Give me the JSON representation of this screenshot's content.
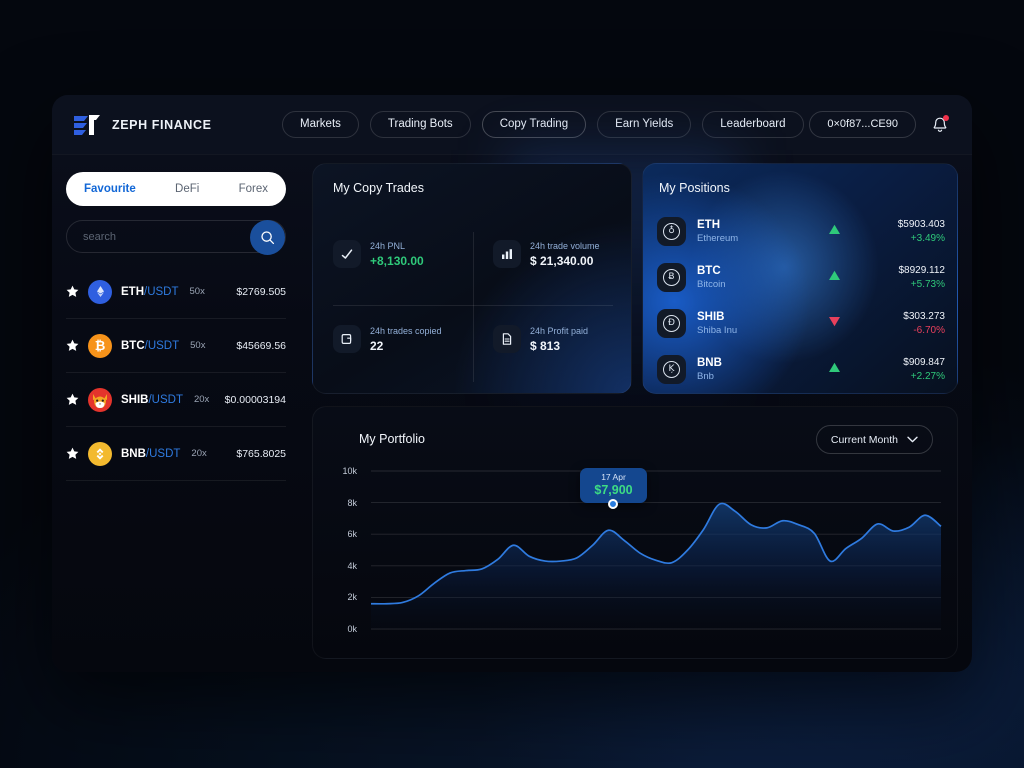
{
  "brand": {
    "name": "ZEPH FINANCE",
    "logo_icon": "zeph-logo-icon"
  },
  "nav": {
    "items": [
      {
        "label": "Markets",
        "active": false
      },
      {
        "label": "Trading Bots",
        "active": false
      },
      {
        "label": "Copy Trading",
        "active": true
      },
      {
        "label": "Earn Yields",
        "active": false
      },
      {
        "label": "Leaderboard",
        "active": false
      }
    ],
    "wallet": "0×0f87...CE90",
    "notification_icon": "bell-icon"
  },
  "sidebar": {
    "tabs": [
      {
        "label": "Favourite",
        "active": true
      },
      {
        "label": "DeFi",
        "active": false
      },
      {
        "label": "Forex",
        "active": false
      }
    ],
    "search": {
      "placeholder": "search",
      "value": "",
      "icon": "search-icon"
    },
    "coins": [
      {
        "base": "ETH",
        "quote": "/USDT",
        "leverage": "50x",
        "price": "$2769.505",
        "color": "#2f5fe0",
        "glyph": "Ξ",
        "favourite": true
      },
      {
        "base": "BTC",
        "quote": "/USDT",
        "leverage": "50x",
        "price": "$45669.56",
        "color": "#f7931a",
        "glyph": "₿",
        "favourite": true
      },
      {
        "base": "SHIB",
        "quote": "/USDT",
        "leverage": "20x",
        "price": "$0.00003194",
        "color": "#e4342c",
        "glyph": "🐶",
        "favourite": true
      },
      {
        "base": "BNB",
        "quote": "/USDT",
        "leverage": "20x",
        "price": "$765.8025",
        "color": "#f3ba2f",
        "glyph": "◈",
        "favourite": true
      }
    ]
  },
  "copy_trades": {
    "title": "My Copy Trades",
    "stats": [
      {
        "label": "24h PNL",
        "value": "+8,130.00",
        "positive": true,
        "icon": "check-icon"
      },
      {
        "label": "24h trade volume",
        "value": "$ 21,340.00",
        "positive": false,
        "icon": "bar-chart-icon"
      },
      {
        "label": "24h trades copied",
        "value": "22",
        "positive": false,
        "icon": "copy-icon"
      },
      {
        "label": "24h Profit paid",
        "value": "$ 813",
        "positive": false,
        "icon": "document-icon"
      }
    ]
  },
  "positions": {
    "title": "My Positions",
    "rows": [
      {
        "symbol": "ETH",
        "name": "Ethereum",
        "price": "$5903.403",
        "change": "+3.49%",
        "direction": "up",
        "glyph": "♁"
      },
      {
        "symbol": "BTC",
        "name": "Bitcoin",
        "price": "$8929.112",
        "change": "+5.73%",
        "direction": "up",
        "glyph": "Ƀ"
      },
      {
        "symbol": "SHIB",
        "name": "Shiba Inu",
        "price": "$303.273",
        "change": "-6.70%",
        "direction": "down",
        "glyph": "Ð"
      },
      {
        "symbol": "BNB",
        "name": "Bnb",
        "price": "$909.847",
        "change": "+2.27%",
        "direction": "up",
        "glyph": "Ķ"
      }
    ]
  },
  "portfolio": {
    "title": "My Portfolio",
    "period": {
      "label": "Current Month",
      "icon": "chevron-down-icon"
    },
    "tooltip": {
      "date": "17 Apr",
      "value": "$7,900"
    }
  },
  "chart_data": {
    "type": "area",
    "title": "My Portfolio",
    "xlabel": "",
    "ylabel": "",
    "ylim": [
      0,
      10000
    ],
    "ytick_labels": [
      "0k",
      "2k",
      "4k",
      "6k",
      "8k",
      "10k"
    ],
    "ytick_values": [
      0,
      2000,
      4000,
      6000,
      8000,
      10000
    ],
    "grid": true,
    "legend": false,
    "line_color": "#2f7be0",
    "fill_color": "#0c2katsu",
    "annotations": [
      {
        "x": 17,
        "y": 7900,
        "date": "17 Apr",
        "label": "$7,900"
      }
    ],
    "series": [
      {
        "name": "Portfolio value",
        "x": [
          0,
          1,
          2,
          3,
          4,
          5,
          6,
          7,
          8,
          9,
          10,
          11,
          12,
          13,
          14,
          15,
          16,
          17,
          18,
          19,
          20,
          21,
          22,
          23,
          24,
          25,
          26,
          27,
          28,
          29,
          30,
          31,
          32,
          33,
          34,
          35,
          36
        ],
        "values": [
          1600,
          1600,
          1680,
          2100,
          2900,
          3550,
          3700,
          3800,
          4400,
          5300,
          4600,
          4300,
          4300,
          4500,
          5300,
          6250,
          5600,
          4800,
          4350,
          4200,
          5000,
          6300,
          7900,
          7450,
          6600,
          6400,
          6850,
          6600,
          6050,
          4300,
          5100,
          5750,
          6650,
          6200,
          6450,
          7200,
          6500
        ]
      }
    ]
  }
}
